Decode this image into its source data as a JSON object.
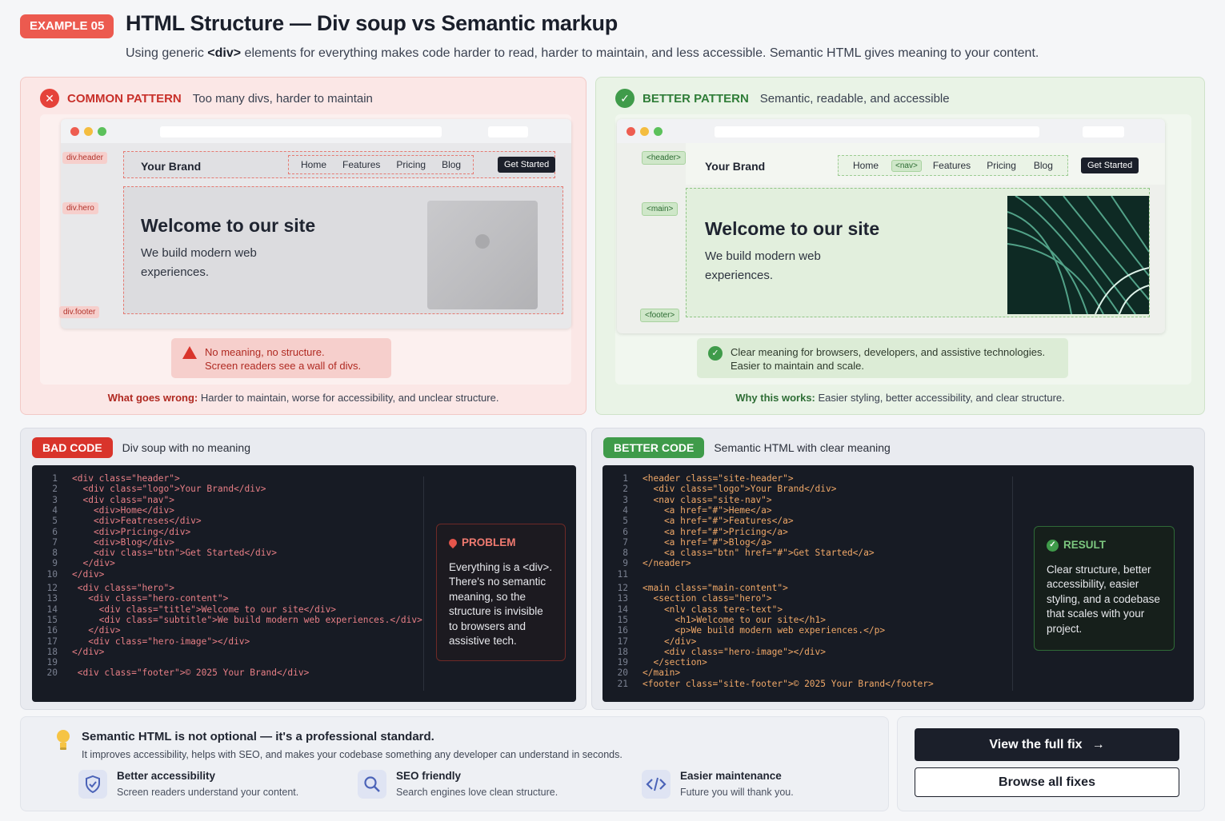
{
  "header": {
    "badge": "EXAMPLE 05",
    "title": "HTML Structure — Div soup vs Semantic markup",
    "subtitle_pre": "Using generic ",
    "subtitle_bold": "<div>",
    "subtitle_post": " elements for everything makes code harder to read, harder to maintain, and less accessible. Semantic HTML gives meaning to your content."
  },
  "bad": {
    "kw": "COMMON PATTERN",
    "desc": "Too many divs, harder to maintain",
    "tags": [
      "div.header",
      "div.hero",
      "div.footer"
    ],
    "brand": "Your Brand",
    "nav": [
      "Home",
      "Features",
      "Pricing",
      "Blog"
    ],
    "cta": "Get Started",
    "hero_title": "Welcome to our site",
    "hero_text": "We build modern web experiences.",
    "note_line1": "No meaning, no structure.",
    "note_line2": "Screen readers see a wall of divs.",
    "foot_bold": "What goes wrong:",
    "foot_text": " Harder to maintain, worse for accessibility, and unclear structure."
  },
  "good": {
    "kw": "BETTER PATTERN",
    "desc": "Semantic, readable, and accessible",
    "tags": [
      "<header>",
      "<main>",
      "<footer>"
    ],
    "nav_tag": "<nav>",
    "brand": "Your Brand",
    "nav": [
      "Home",
      "Features",
      "Pricing",
      "Blog"
    ],
    "cta": "Get Started",
    "hero_title": "Welcome to our site",
    "hero_text": "We build modern web experiences.",
    "note_line1": "Clear meaning for browsers, developers, and assistive technologies.",
    "note_line2": "Easier to maintain and scale.",
    "foot_bold": "Why this works:",
    "foot_text": " Easier styling, better accessibility, and clear structure."
  },
  "bad_code": {
    "badge": "BAD CODE",
    "desc": "Div soup with no meaning",
    "callout_title": "PROBLEM",
    "callout_text": "Everything is a <div>. There's no semantic meaning, so the structure is invisible to browsers and assistive tech.",
    "lines": [
      {
        "n": "1",
        "c": "<div class=\"header\">"
      },
      {
        "n": "2",
        "c": "  <div class=\"logo\">Your Brand</div>"
      },
      {
        "n": "3",
        "c": "  <div class=\"nav\">"
      },
      {
        "n": "4",
        "c": "    <div>Home</div>"
      },
      {
        "n": "5",
        "c": "    <div>Featreses</div>"
      },
      {
        "n": "6",
        "c": "    <div>Pricing</div>"
      },
      {
        "n": "7",
        "c": "    <div>Blog</div>"
      },
      {
        "n": "8",
        "c": "    <div class=\"btn\">Get Started</div>"
      },
      {
        "n": "9",
        "c": "  </div>"
      },
      {
        "n": "10",
        "c": "</div>"
      },
      {
        "n": "12",
        "c": " <div class=\"hero\">"
      },
      {
        "n": "13",
        "c": "   <div class=\"hero-content\">"
      },
      {
        "n": "14",
        "c": "     <div class=\"title\">Welcome to our site</div>"
      },
      {
        "n": "15",
        "c": "     <div class=\"subtitle\">We build modern web experiences.</div>"
      },
      {
        "n": "16",
        "c": "   </div>"
      },
      {
        "n": "17",
        "c": "   <div class=\"hero-image\"></div>"
      },
      {
        "n": "18",
        "c": "</div>"
      },
      {
        "n": "19",
        "c": ""
      },
      {
        "n": "20",
        "c": " <div class=\"footer\">© 2025 Your Brand</div>"
      }
    ]
  },
  "good_code": {
    "badge": "BETTER CODE",
    "desc": "Semantic HTML with clear meaning",
    "callout_title": "RESULT",
    "callout_text": "Clear structure, better accessibility, easier styling, and a codebase that scales with your project.",
    "lines": [
      {
        "n": "1",
        "c": "<header class=\"site-header\">"
      },
      {
        "n": "2",
        "c": "  <div class=\"logo\">Your Brand</div>"
      },
      {
        "n": "3",
        "c": "  <nav class=\"site-nav\">"
      },
      {
        "n": "4",
        "c": "    <a href=\"#\">Heme</a>"
      },
      {
        "n": "5",
        "c": "    <a href=\"#\">Features</a>"
      },
      {
        "n": "6",
        "c": "    <a href=\"#\">Pricing</a>"
      },
      {
        "n": "7",
        "c": "    <a href=\"#\">Blog</a>"
      },
      {
        "n": "8",
        "c": "    <a class=\"btn\" href=\"#\">Get Started</a>"
      },
      {
        "n": "9",
        "c": "</neader>"
      },
      {
        "n": "11",
        "c": ""
      },
      {
        "n": "12",
        "c": "<main class=\"main-content\">"
      },
      {
        "n": "13",
        "c": "  <section class=\"hero\">"
      },
      {
        "n": "14",
        "c": "    <nlv class tere-text\">"
      },
      {
        "n": "15",
        "c": "      <h1>Welcome to our site</h1>"
      },
      {
        "n": "16",
        "c": "      <p>We build modern web experiences.</p>"
      },
      {
        "n": "17",
        "c": "    </div>"
      },
      {
        "n": "18",
        "c": "    <div class=\"hero-image\"></div>"
      },
      {
        "n": "19",
        "c": "  </section>"
      },
      {
        "n": "20",
        "c": "</main>"
      },
      {
        "n": "21",
        "c": "<footer class=\"site-footer\">© 2025 Your Brand</footer>"
      }
    ]
  },
  "bottom": {
    "title": "Semantic HTML is not optional — it's a professional standard.",
    "text": "It improves accessibility, helps with SEO, and makes your codebase something any developer can understand in seconds.",
    "features": [
      {
        "title": "Better accessibility",
        "desc": "Screen readers understand your content.",
        "icon": "shield-icon"
      },
      {
        "title": "SEO friendly",
        "desc": "Search engines love clean structure.",
        "icon": "search-icon"
      },
      {
        "title": "Easier maintenance",
        "desc": "Future you will thank you.",
        "icon": "code-icon"
      }
    ]
  },
  "actions": {
    "primary": "View the full fix",
    "secondary": "Browse all fixes"
  },
  "colors": {
    "bad": "#e5423a",
    "good": "#3f9b4a",
    "dark": "#1b1f2a"
  }
}
